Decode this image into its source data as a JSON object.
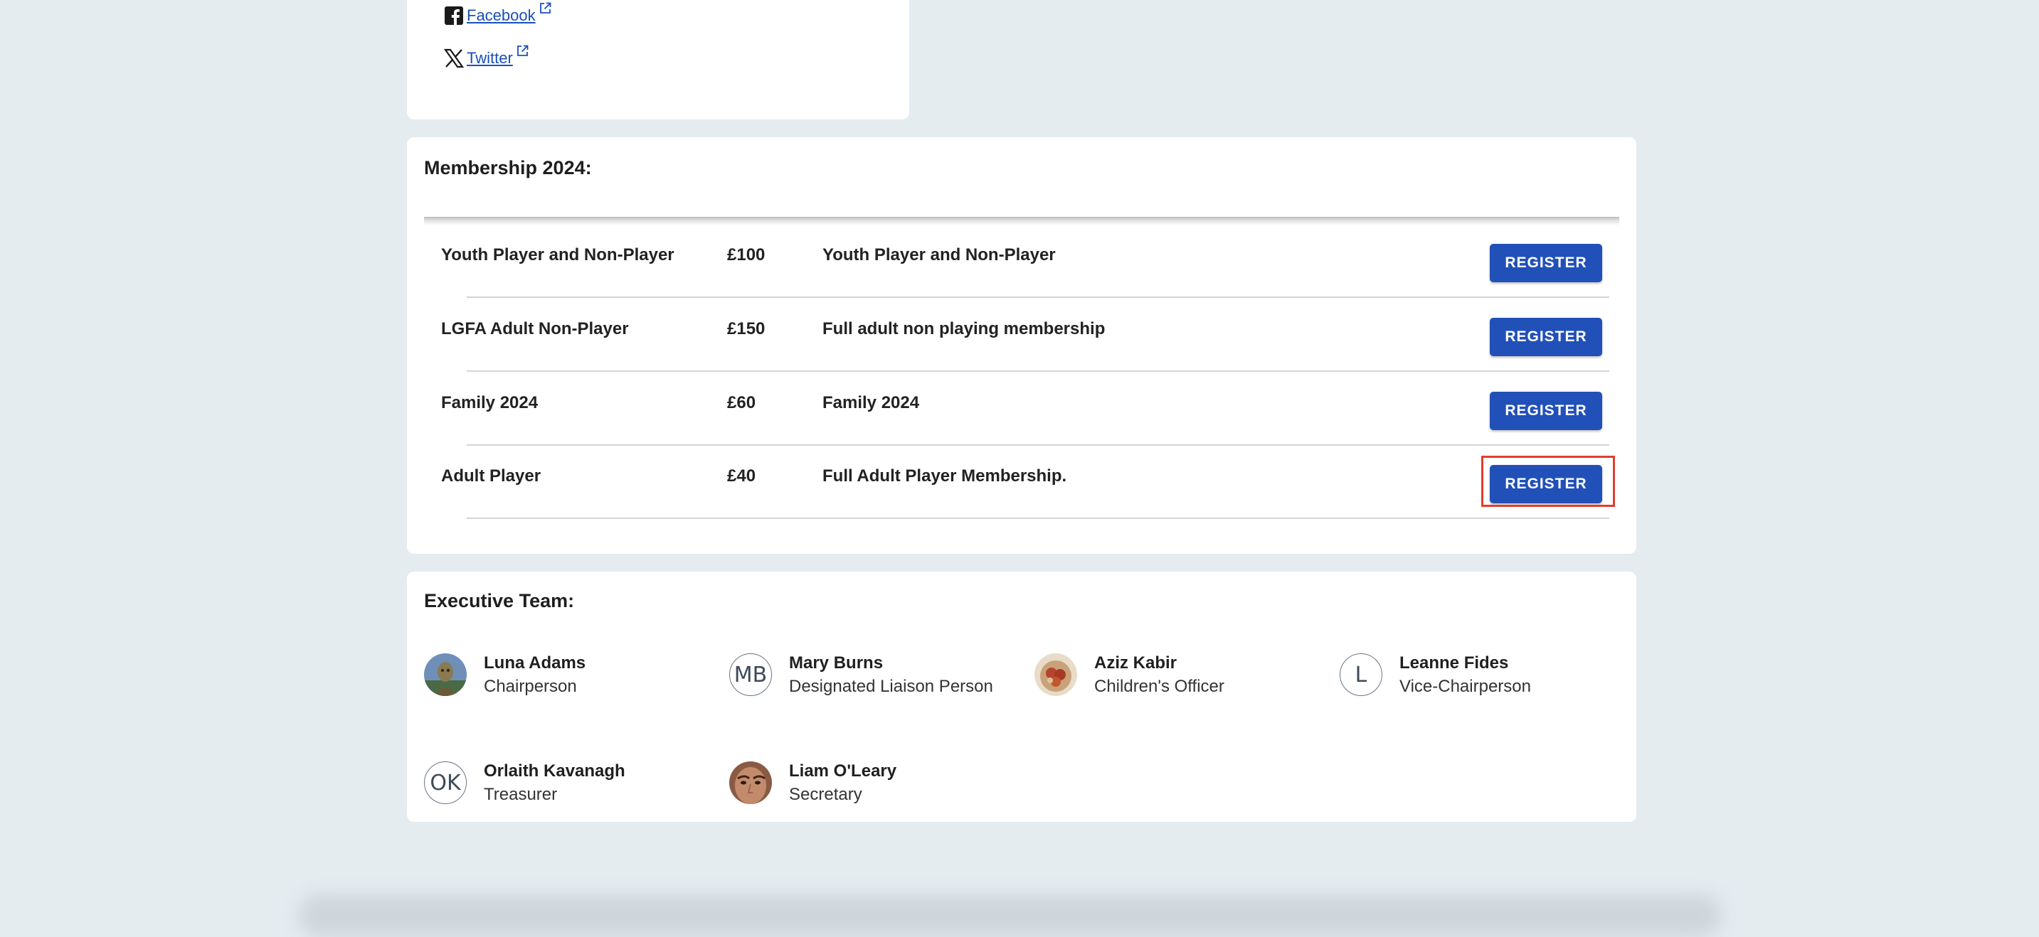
{
  "social": {
    "links": [
      {
        "label": "Facebook",
        "icon": "facebook-icon"
      },
      {
        "label": "Twitter",
        "icon": "x-twitter-icon"
      }
    ]
  },
  "membership": {
    "title": "Membership 2024:",
    "register_label": "REGISTER",
    "rows": [
      {
        "name": "Youth Player and Non-Player",
        "price": "£100",
        "description": "Youth Player and Non-Player"
      },
      {
        "name": "LGFA Adult Non-Player",
        "price": "£150",
        "description": "Full adult non playing membership"
      },
      {
        "name": "Family 2024",
        "price": "£60",
        "description": "Family 2024"
      },
      {
        "name": "Adult Player",
        "price": "£40",
        "description": "Full Adult Player Membership."
      }
    ]
  },
  "executive": {
    "title": "Executive Team:",
    "members": [
      {
        "name": "Luna Adams",
        "role": "Chairperson",
        "avatar": "photo"
      },
      {
        "name": "Mary Burns",
        "role": "Designated Liaison Person",
        "avatar": "MB"
      },
      {
        "name": "Aziz Kabir",
        "role": "Children's Officer",
        "avatar": "photo"
      },
      {
        "name": "Leanne Fides",
        "role": "Vice-Chairperson",
        "avatar": "L"
      },
      {
        "name": "Orlaith Kavanagh",
        "role": "Treasurer",
        "avatar": "OK"
      },
      {
        "name": "Liam O'Leary",
        "role": "Secretary",
        "avatar": "photo"
      }
    ]
  },
  "colors": {
    "page_bg": "#e4ecf0",
    "card_bg": "#ffffff",
    "button_bg": "#2150b8",
    "link": "#1a4fb8",
    "highlight": "#e03e2d"
  }
}
